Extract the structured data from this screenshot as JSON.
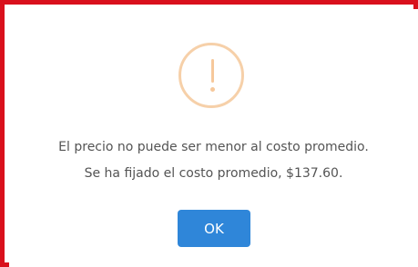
{
  "dialog": {
    "icon": "warning-exclamation-icon",
    "message_line1": "El precio no puede ser menor al costo promedio.",
    "message_line2": "Se ha fijado el costo promedio, $137.60.",
    "ok_label": "OK"
  },
  "colors": {
    "highlight_border": "#d9101c",
    "icon_color": "#f6c89b",
    "button_bg": "#2f86d9",
    "text_color": "#545454"
  }
}
